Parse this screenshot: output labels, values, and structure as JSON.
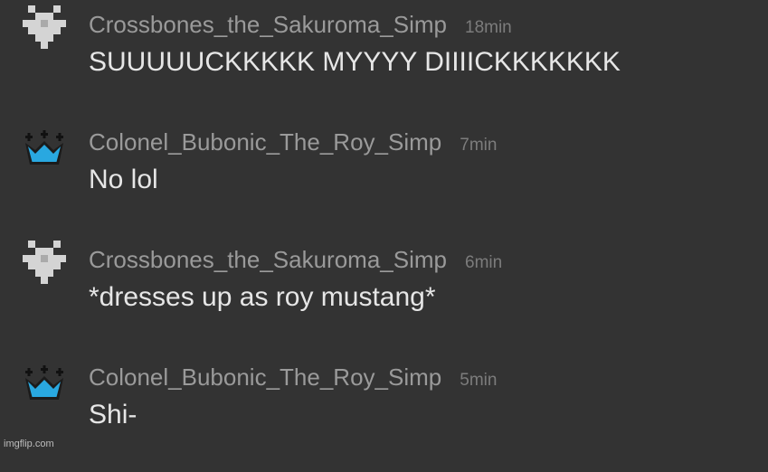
{
  "comments": [
    {
      "username": "Crossbones_the_Sakuroma_Simp",
      "time": "18min",
      "message": "SUUUUUCKKKKK MYYYY DIIIICKKKKKKK",
      "avatar_icon": "pixel-heart-icon"
    },
    {
      "username": "Colonel_Bubonic_The_Roy_Simp",
      "time": "7min",
      "message": "No lol",
      "avatar_icon": "crown-icon"
    },
    {
      "username": "Crossbones_the_Sakuroma_Simp",
      "time": "6min",
      "message": "*dresses up as roy mustang*",
      "avatar_icon": "pixel-heart-icon"
    },
    {
      "username": "Colonel_Bubonic_The_Roy_Simp",
      "time": "5min",
      "message": "Shi-",
      "avatar_icon": "crown-icon"
    }
  ],
  "watermark": "imgflip.com",
  "colors": {
    "background": "#333333",
    "username": "#9a9a9a",
    "timestamp": "#7c7c7c",
    "message": "#e6e6e6",
    "crown": "#29a8e0"
  }
}
